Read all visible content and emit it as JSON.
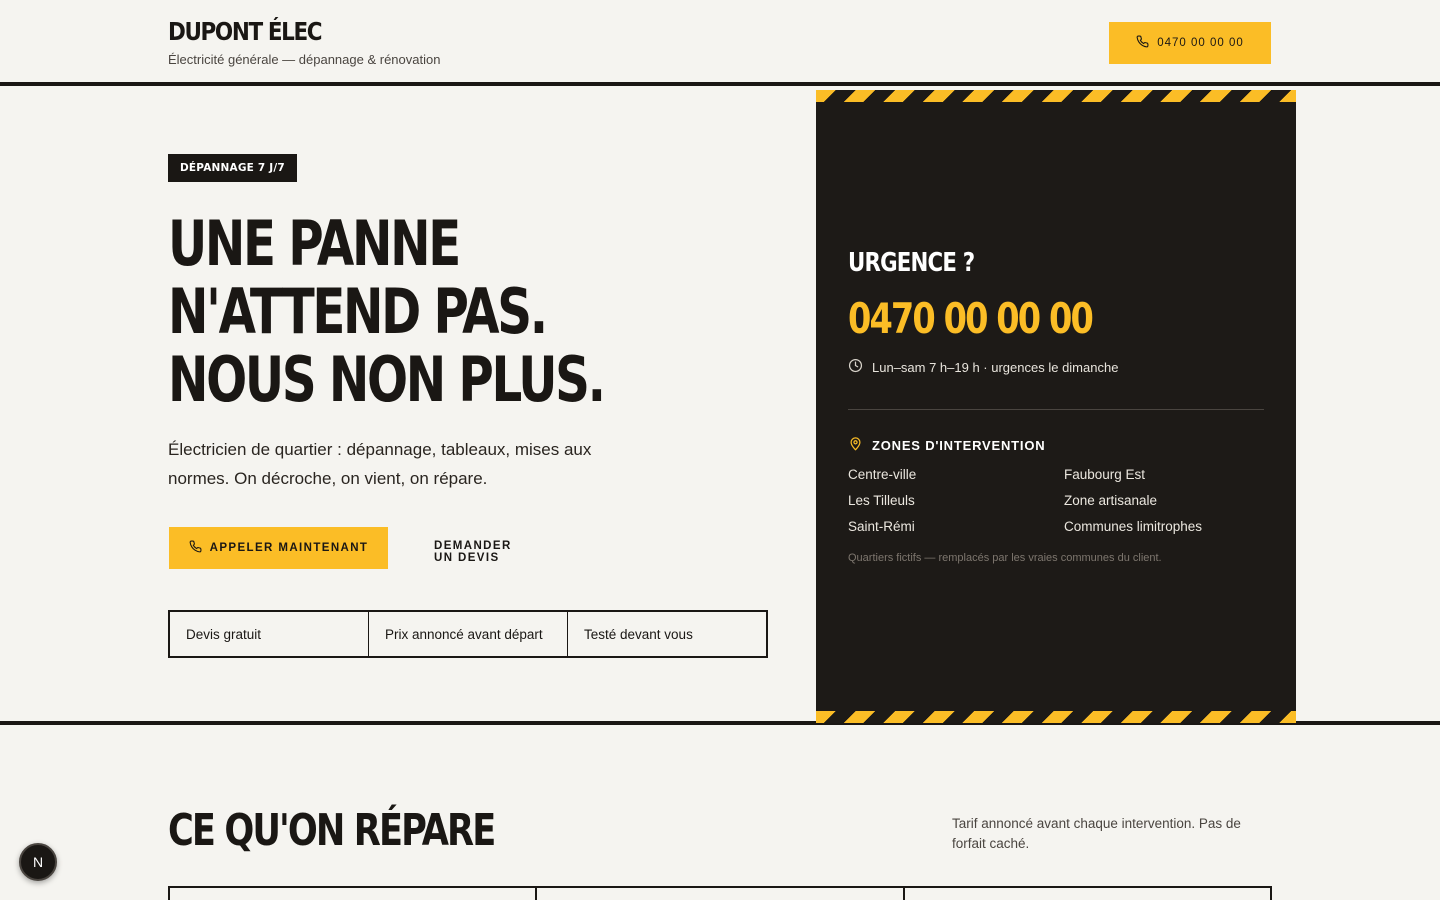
{
  "header": {
    "brand_name": "DUPONT ÉLEC",
    "brand_tagline": "Électricité générale — dépannage & rénovation",
    "phone_button": "0470 00 00 00"
  },
  "hero": {
    "badge": "DÉPANNAGE 7 J/7",
    "headline_lines": [
      "UNE PANNE",
      "N'ATTEND PAS.",
      "NOUS NON PLUS."
    ],
    "intro": "Électricien de quartier : dépannage, tableaux, mises aux normes. On décroche, on vient, on répare.",
    "cta_primary": "APPELER MAINTENANT",
    "cta_secondary": "DEMANDER UN DEVIS",
    "features": [
      "Devis gratuit",
      "Prix annoncé avant départ",
      "Testé devant vous"
    ]
  },
  "emergency_panel": {
    "title": "URGENCE ?",
    "phone": "0470 00 00 00",
    "hours": "Lun–sam 7 h–19 h · urgences le dimanche",
    "zones_title": "ZONES D'INTERVENTION",
    "zones": [
      "Centre-ville",
      "Faubourg Est",
      "Les Tilleuls",
      "Zone artisanale",
      "Saint-Rémi",
      "Communes limitrophes"
    ],
    "zones_note": "Quartiers fictifs — remplacés par les vraies communes du client."
  },
  "services": {
    "title": "CE QU'ON RÉPARE",
    "note": "Tarif annoncé avant chaque intervention. Pas de forfait caché."
  },
  "dev_tools": {
    "label": "N"
  },
  "colors": {
    "accent": "#fbbd26",
    "dark": "#1d1a17",
    "background": "#f5f4f0"
  },
  "icons": {
    "phone": "phone-icon",
    "clock": "clock-icon",
    "pin": "map-pin-icon"
  }
}
